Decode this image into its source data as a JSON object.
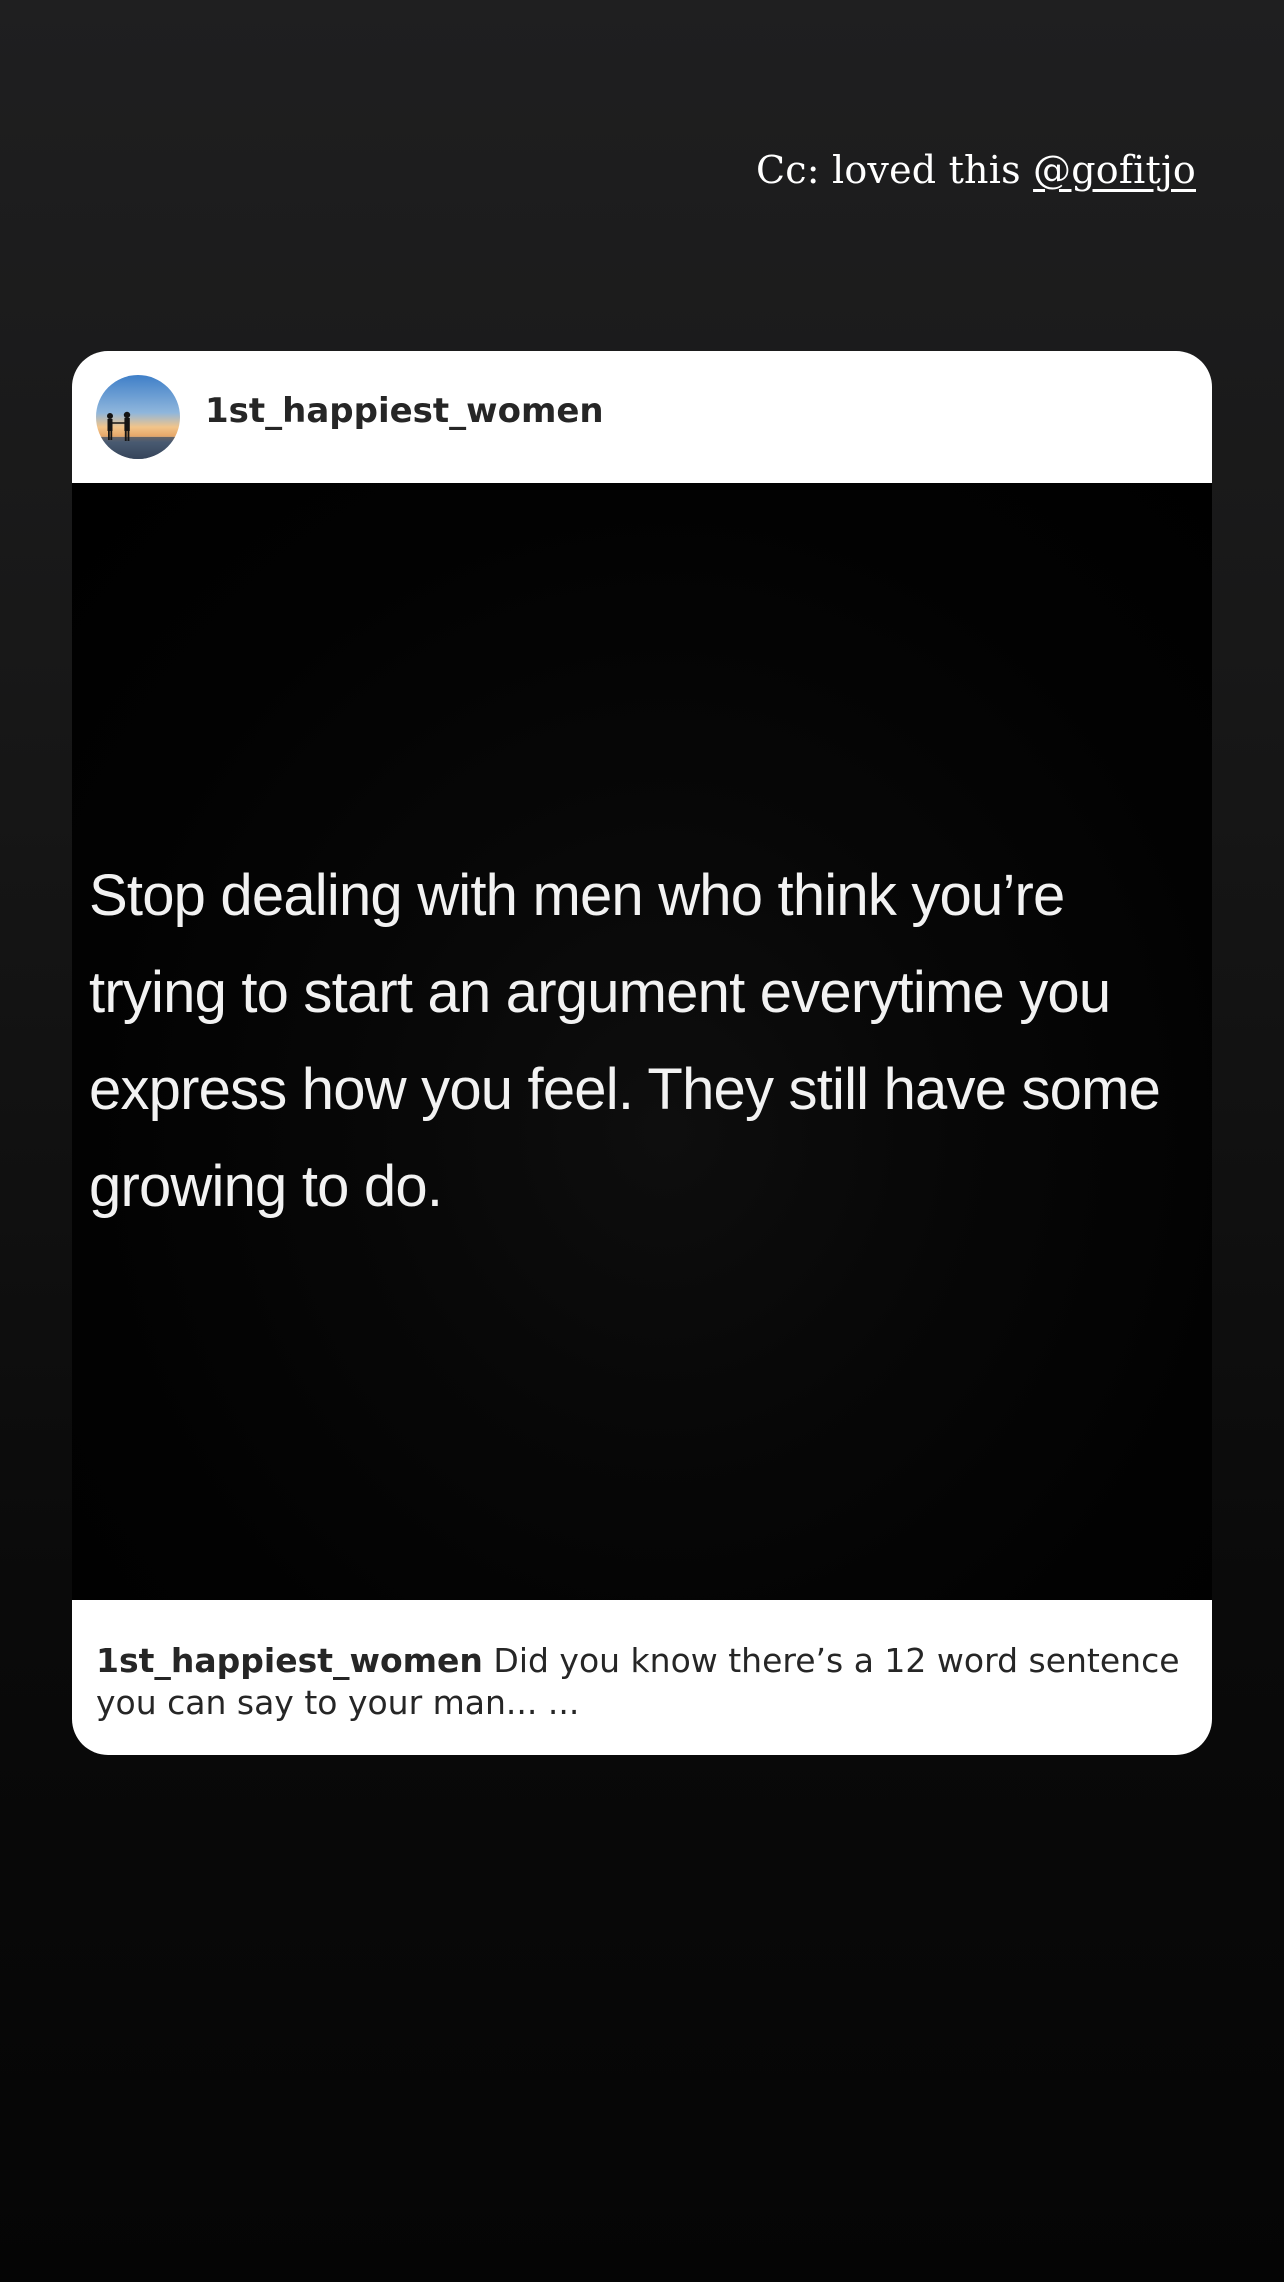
{
  "story": {
    "caption_prefix": "Cc: loved this ",
    "caption_mention": "@gofitjo"
  },
  "post": {
    "username": "1st_happiest_women",
    "avatar_icon": "avatar-sunset-couple-icon",
    "quote": "Stop dealing with men who think you’re trying to start an argument everytime you express how you feel. They still have some growing to do.",
    "caption_username": "1st_happiest_women",
    "caption_text": " Did you know there’s a 12 word sentence you can say to your man...   ..."
  }
}
